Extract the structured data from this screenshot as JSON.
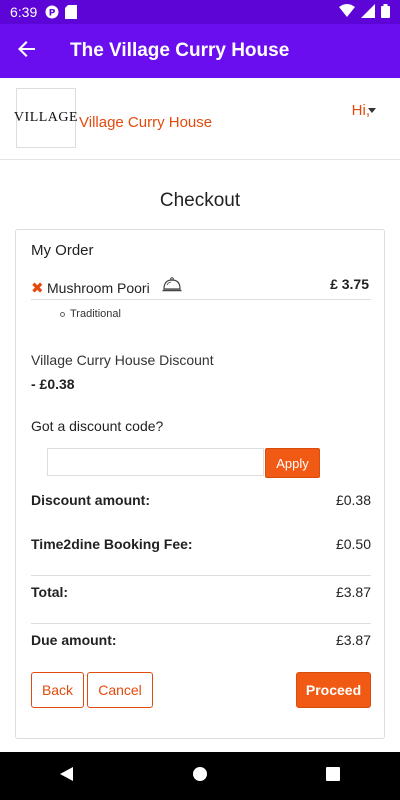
{
  "status_bar": {
    "time": "6:39",
    "icons_left": [
      "p-circle-icon",
      "sd-card-icon"
    ],
    "icons_right": [
      "wifi-icon",
      "signal-icon",
      "battery-icon"
    ]
  },
  "app_bar": {
    "title": "The Village Curry House",
    "back_icon": "arrow-left-icon"
  },
  "restaurant": {
    "logo_text": "VILLAGE",
    "name": "Village Curry House",
    "greeting": "Hi,"
  },
  "page": {
    "title": "Checkout"
  },
  "order": {
    "section_title": "My Order",
    "items": [
      {
        "name": "Mushroom Poori",
        "price": "£ 3.75",
        "option": "Traditional"
      }
    ],
    "restaurant_discount_label": "Village Curry House Discount",
    "restaurant_discount_value": "- £0.38",
    "discount_code_label": "Got a discount code?",
    "discount_code_value": "",
    "discount_code_placeholder": "",
    "apply_label": "Apply"
  },
  "summary": {
    "discount_amount_label": "Discount amount:",
    "discount_amount_value": "£0.38",
    "booking_fee_label": "Time2dine Booking Fee:",
    "booking_fee_value": "£0.50",
    "total_label": "Total:",
    "total_value": "£3.87",
    "due_label": "Due amount:",
    "due_value": "£3.87"
  },
  "actions": {
    "back_label": "Back",
    "cancel_label": "Cancel",
    "proceed_label": "Proceed"
  },
  "colors": {
    "primary": "#6a0ef0",
    "accent": "#f05a14",
    "accent_text": "#e34a0d"
  }
}
